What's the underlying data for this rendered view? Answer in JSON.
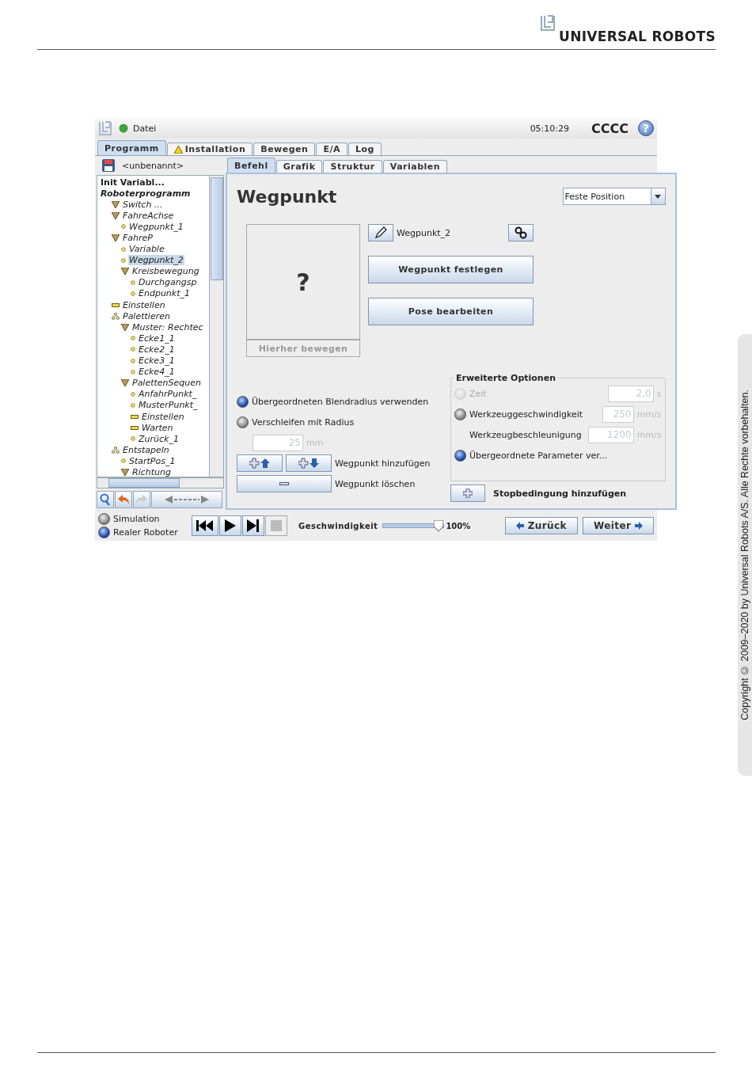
{
  "header": {
    "brand": "UNIVERSAL ROBOTS"
  },
  "app": {
    "top_bar": {
      "menu": "Datei",
      "time": "05:10:29",
      "robot_name": "CCCC",
      "help": "?"
    },
    "main_tabs": [
      {
        "label": "Programm",
        "selected": true,
        "warning": false
      },
      {
        "label": "Installation",
        "selected": false,
        "warning": true
      },
      {
        "label": "Bewegen",
        "selected": false,
        "warning": false
      },
      {
        "label": "E/A",
        "selected": false,
        "warning": false
      },
      {
        "label": "Log",
        "selected": false,
        "warning": false
      }
    ],
    "program_name": "<unbenannt>",
    "tree": [
      {
        "label": "Init Variabl...",
        "kind": "init",
        "selected": false
      },
      {
        "label": "Roboterprogramm",
        "kind": "program",
        "selected": false,
        "children": [
          {
            "label": "Switch ...",
            "kind": "folder",
            "selected": false
          },
          {
            "label": "FahreAchse",
            "kind": "folder",
            "selected": false,
            "children": [
              {
                "label": "Wegpunkt_1",
                "kind": "waypoint",
                "selected": false
              }
            ]
          },
          {
            "label": "FahreP",
            "kind": "folder",
            "selected": false,
            "children": [
              {
                "label": "Variable",
                "kind": "waypoint",
                "selected": false
              },
              {
                "label": "Wegpunkt_2",
                "kind": "waypoint",
                "selected": true
              },
              {
                "label": "Kreisbewegung",
                "kind": "folder",
                "selected": false,
                "children": [
                  {
                    "label": "Durchgangsp",
                    "kind": "waypoint",
                    "selected": false
                  },
                  {
                    "label": "Endpunkt_1",
                    "kind": "waypoint",
                    "selected": false
                  }
                ]
              }
            ]
          },
          {
            "label": "Einstellen",
            "kind": "set",
            "selected": false
          },
          {
            "label": "Palettieren",
            "kind": "pallet",
            "selected": false,
            "children": [
              {
                "label": "Muster: Rechtec",
                "kind": "folder",
                "selected": false,
                "children": [
                  {
                    "label": "Ecke1_1",
                    "kind": "waypoint",
                    "selected": false
                  },
                  {
                    "label": "Ecke2_1",
                    "kind": "waypoint",
                    "selected": false
                  },
                  {
                    "label": "Ecke3_1",
                    "kind": "waypoint",
                    "selected": false
                  },
                  {
                    "label": "Ecke4_1",
                    "kind": "waypoint",
                    "selected": false
                  }
                ]
              },
              {
                "label": "PalettenSequen",
                "kind": "folder",
                "selected": false,
                "children": [
                  {
                    "label": "AnfahrPunkt_",
                    "kind": "waypoint",
                    "selected": false
                  },
                  {
                    "label": "MusterPunkt_",
                    "kind": "waypoint",
                    "selected": false
                  },
                  {
                    "label": "Einstellen",
                    "kind": "set",
                    "selected": false
                  },
                  {
                    "label": "Warten",
                    "kind": "set",
                    "selected": false
                  },
                  {
                    "label": "Zurück_1",
                    "kind": "waypoint",
                    "selected": false
                  }
                ]
              }
            ]
          },
          {
            "label": "Entstapeln",
            "kind": "pallet",
            "selected": false,
            "children": [
              {
                "label": "StartPos_1",
                "kind": "waypoint",
                "selected": false
              },
              {
                "label": "Richtung",
                "kind": "folder",
                "selected": false
              }
            ]
          }
        ]
      }
    ],
    "sub_tabs": [
      {
        "label": "Befehl",
        "selected": true
      },
      {
        "label": "Grafik",
        "selected": false
      },
      {
        "label": "Struktur",
        "selected": false
      },
      {
        "label": "Variablen",
        "selected": false
      }
    ],
    "panel": {
      "title": "Wegpunkt",
      "position_type": "Feste Position",
      "preview_symbol": "?",
      "move_here": {
        "label": "Hierher bewegen",
        "disabled": true
      },
      "waypoint_name": "Wegpunkt_2",
      "set_waypoint": "Wegpunkt festlegen",
      "edit_pose": "Pose bearbeiten",
      "blend_options": [
        {
          "label": "Übergeordneten Blendradius verwenden",
          "selected": true
        },
        {
          "label": "Verschleifen mit Radius",
          "selected": false
        }
      ],
      "radius": {
        "value": "25",
        "unit": "mm",
        "disabled": true
      },
      "add_waypoint": "Wegpunkt hinzufügen",
      "delete_waypoint": "Wegpunkt löschen",
      "advanced": {
        "title": "Erweiterte Optionen",
        "options": [
          {
            "kind": "radio",
            "label": "Zeit",
            "selected": false,
            "disabled": true,
            "value": "2,0",
            "unit": "s"
          },
          {
            "kind": "radio",
            "label": "Werkzeuggeschwindigkeit",
            "selected": false,
            "disabled": false,
            "value": "250",
            "unit": "mm/s"
          },
          {
            "kind": "field",
            "label": "Werkzeugbeschleunigung",
            "value": "1200",
            "unit": "mm/s"
          },
          {
            "kind": "radio",
            "label": "Übergeordnete Parameter ver...",
            "selected": true,
            "disabled": false
          }
        ]
      },
      "stop_condition": "Stopbedingung hinzufügen"
    },
    "bottom_bar": {
      "modes": [
        {
          "label": "Simulation",
          "selected": false
        },
        {
          "label": "Realer Roboter",
          "selected": true
        }
      ],
      "speed_label": "Geschwindigkeit",
      "speed": {
        "level": 1.0
      },
      "speed_reading": "100%",
      "back": "Zurück",
      "next": "Weiter"
    }
  },
  "copyright": "Copyright © 2009–2020 by Universal Robots A/S. Alle Rechte vorbehalten."
}
